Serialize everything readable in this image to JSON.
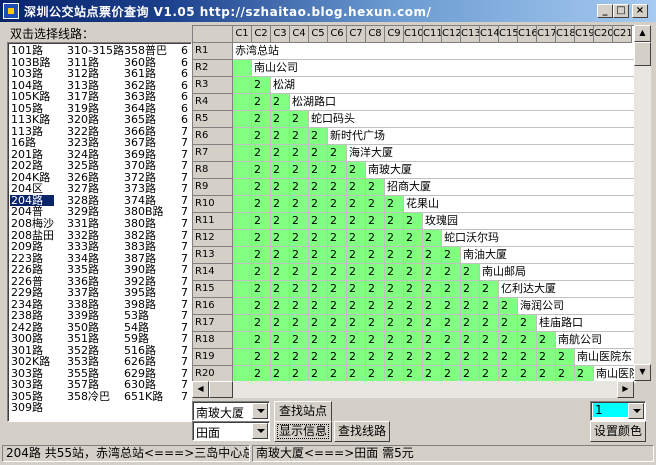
{
  "window": {
    "title": "深圳公交站点票价查询 V1.05  http://szhaitao.blog.hexun.com/"
  },
  "left": {
    "label": "双击选择线路：",
    "selected": "204路",
    "columns": [
      [
        "101路",
        "103B路",
        "103路",
        "104路",
        "105K路",
        "105路",
        "113K路",
        "113路",
        "16路",
        "201路",
        "202路",
        "204K路",
        "204区",
        "204路",
        "204普",
        "208梅沙",
        "208盐田",
        "209路",
        "223路",
        "226路",
        "226普",
        "229路",
        "234路",
        "238路",
        "242路",
        "300路",
        "301路",
        "302K路",
        "303路",
        "303路",
        "305路",
        "309路"
      ],
      [
        "310-315路",
        "311路",
        "312路",
        "313路",
        "317路",
        "319路",
        "320路",
        "322路",
        "323路",
        "324路",
        "325路",
        "326路",
        "327路",
        "328路",
        "329路",
        "331路",
        "332路",
        "333路",
        "334路",
        "335路",
        "336路",
        "337路",
        "338路",
        "339路",
        "350路",
        "351路",
        "352路",
        "353路",
        "355路",
        "357路",
        "358冷巴"
      ],
      [
        "358普巴",
        "360路",
        "361路",
        "362路",
        "363路",
        "364路",
        "365路",
        "366路",
        "367路",
        "369路",
        "370路",
        "372路",
        "373路",
        "374路",
        "380B路",
        "380路",
        "382路",
        "383路",
        "387路",
        "390路",
        "392路",
        "395路",
        "398路",
        "53路",
        "54路",
        "59路",
        "516路",
        "626路",
        "629路",
        "630路",
        "651K路"
      ],
      [
        "6",
        "6",
        "6",
        "6",
        "6",
        "6",
        "6",
        "7",
        "7",
        "7",
        "7",
        "7",
        "7",
        "7",
        "7",
        "7",
        "7",
        "7",
        "7",
        "7",
        "7",
        "7",
        "7",
        "7",
        "7",
        "7",
        "7",
        "7",
        "7",
        "7",
        "7"
      ]
    ]
  },
  "grid": {
    "columns": [
      "C1",
      "C2",
      "C3",
      "C4",
      "C5",
      "C6",
      "C7",
      "C8",
      "C9",
      "C10",
      "C11",
      "C12",
      "C13",
      "C14",
      "C15",
      "C16",
      "C17",
      "C18",
      "C19",
      "C20",
      "C21"
    ],
    "rows": [
      "R1",
      "R2",
      "R3",
      "R4",
      "R5",
      "R6",
      "R7",
      "R8",
      "R9",
      "R10",
      "R11",
      "R12",
      "R13",
      "R14",
      "R15",
      "R16",
      "R17",
      "R18",
      "R19",
      "R20"
    ],
    "stations": [
      "赤湾总站",
      "南山公司",
      "松湖",
      "松湖路口",
      "蛇口码头",
      "新时代广场",
      "海洋大厦",
      "南玻大厦",
      "招商大厦",
      "花果山",
      "玫瑰园",
      "蛇口沃尔玛",
      "南油大厦",
      "南山邮局",
      "亿利达大厦",
      "海润公司",
      "桂庙路口",
      "南航公司",
      "南山医院东",
      "南山医院"
    ],
    "fare": "2"
  },
  "controls": {
    "from_station": "南玻大厦",
    "to_station": "田面",
    "find_station": "查找站点",
    "show_info": "显示信息",
    "find_route": "查找线路",
    "color_value": "1",
    "set_color": "设置颜色"
  },
  "status": {
    "route_info": "204路 共55站，赤湾总站<===>三岛中心总站",
    "fare_info": "南玻大厦<===>田面 需5元"
  },
  "colors": {
    "cell_bg": "#80ff80",
    "title_start": "#0a246a",
    "title_end": "#a6caf0",
    "selected_bg": "#0a246a",
    "color_swatch": "#00ffff"
  }
}
